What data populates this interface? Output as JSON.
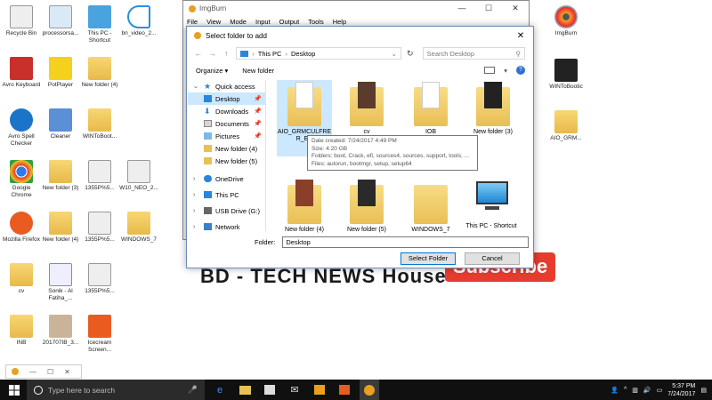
{
  "desktop": {
    "icons": [
      {
        "label": "Recycle Bin"
      },
      {
        "label": "processorsa..."
      },
      {
        "label": "This PC - Shortcut"
      },
      {
        "label": "bn_video_2..."
      },
      {
        "label": "Avro Keyboard"
      },
      {
        "label": "PotPlayer"
      },
      {
        "label": "New folder (4)"
      },
      {
        "label": "Avro Spell Checker"
      },
      {
        "label": "Cleaner"
      },
      {
        "label": "WINToBoot..."
      },
      {
        "label": "Google Chrome"
      },
      {
        "label": "New folder (3)"
      },
      {
        "label": "1355P%5..."
      },
      {
        "label": "W10_NEO_2..."
      },
      {
        "label": "Mozilla Firefox"
      },
      {
        "label": "New folder (4)"
      },
      {
        "label": "1355P%5..."
      },
      {
        "label": "WINDOWS_7"
      },
      {
        "label": "cv"
      },
      {
        "label": "Sonik - Al Fatiha_..."
      },
      {
        "label": "1355P%5..."
      },
      {
        "label": "INB"
      },
      {
        "label": "201707IB_3..."
      },
      {
        "label": "Icecream Screen..."
      }
    ],
    "right_icons": [
      {
        "label": "ImgBurn"
      },
      {
        "label": "WINToBootic"
      },
      {
        "label": "AIO_GRM..."
      }
    ]
  },
  "imgburn": {
    "title": "ImgBurn",
    "menu": [
      "File",
      "View",
      "Mode",
      "Input",
      "Output",
      "Tools",
      "Help"
    ]
  },
  "dialog": {
    "title": "Select folder to add",
    "close_glyph": "✕",
    "address": {
      "back": "←",
      "forward": "→",
      "up": "↑",
      "path": [
        "This PC",
        "Desktop"
      ],
      "search_placeholder": "Search Desktop"
    },
    "toolbar": {
      "organize": "Organize ▾",
      "new_folder": "New folder",
      "help": "?"
    },
    "nav": [
      {
        "label": "Quick access",
        "selected": false
      },
      {
        "label": "Desktop",
        "selected": true
      },
      {
        "label": "Downloads",
        "selected": false
      },
      {
        "label": "Documents",
        "selected": false
      },
      {
        "label": "Pictures",
        "selected": false
      },
      {
        "label": "New folder (4)",
        "selected": false
      },
      {
        "label": "New folder (5)",
        "selected": false
      },
      {
        "label": "OneDrive",
        "selected": false
      },
      {
        "label": "This PC",
        "selected": false
      },
      {
        "label": "USB Drive (G:)",
        "selected": false
      },
      {
        "label": "Network",
        "selected": false
      }
    ],
    "files": [
      {
        "name": "AIO_GRMCULFRE R_EN"
      },
      {
        "name": "cv"
      },
      {
        "name": "IOB"
      },
      {
        "name": "New folder (3)"
      },
      {
        "name": "New folder (4)"
      },
      {
        "name": "New folder (5)"
      },
      {
        "name": "WINDOWS_7"
      },
      {
        "name": "This PC - Shortcut"
      }
    ],
    "tooltip": {
      "created": "Date created: 7/24/2017 4:49 PM",
      "size": "Size: 4.20 GB",
      "folders": "Folders: boot, Crack, efi, sources4, sources, support, tools, ...",
      "files": "Files: autorun, bootmgr, setup, setup64"
    },
    "folder_label": "Folder:",
    "folder_value": "Desktop",
    "select_button": "Select Folder",
    "cancel_button": "Cancel"
  },
  "background": {
    "banner_text": "BD - TECH NEWS House",
    "subscribe": "Subscribe"
  },
  "taskbar": {
    "search_placeholder": "Type here to search",
    "time": "5:37 PM",
    "date": "7/24/2017"
  },
  "colors": {
    "accent": "#0078d7",
    "selection": "#cce8ff",
    "taskbar": "#101010",
    "subscribe": "#e63c2f"
  }
}
